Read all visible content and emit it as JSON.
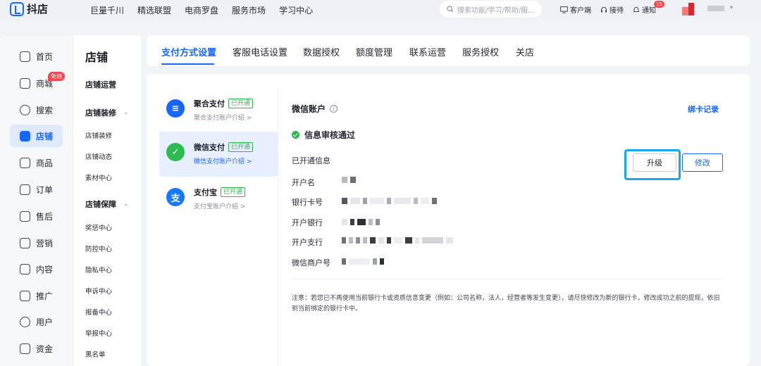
{
  "app": {
    "logo_text": "抖店"
  },
  "topnav": [
    "巨量千川",
    "精选联盟",
    "电商罗盘",
    "服务市场",
    "学习中心"
  ],
  "search": {
    "placeholder": "搜索功能/学习/帮助/服..."
  },
  "top_right": {
    "client": "客户端",
    "reception": "接待",
    "notify": "通知",
    "notify_count": "15"
  },
  "sidebar": {
    "items": [
      {
        "label": "首页",
        "icon": "home-icon"
      },
      {
        "label": "商城",
        "icon": "shop-icon",
        "badge": "免佣"
      },
      {
        "label": "搜索",
        "icon": "search-icon"
      },
      {
        "label": "店铺",
        "icon": "store-icon",
        "active": true
      },
      {
        "label": "商品",
        "icon": "goods-icon"
      },
      {
        "label": "订单",
        "icon": "order-icon"
      },
      {
        "label": "售后",
        "icon": "after-sale-icon"
      },
      {
        "label": "营销",
        "icon": "marketing-icon"
      },
      {
        "label": "内容",
        "icon": "content-icon"
      },
      {
        "label": "推广",
        "icon": "promote-icon"
      },
      {
        "label": "用户",
        "icon": "user-icon"
      },
      {
        "label": "资金",
        "icon": "fund-icon"
      }
    ]
  },
  "subnav": {
    "title": "店铺",
    "ops": "店铺运营",
    "decor_group": "店铺装修",
    "decor_items": [
      "店铺装修",
      "店铺动态",
      "素材中心"
    ],
    "guard_group": "店铺保障",
    "guard_items": [
      "奖惩中心",
      "防控中心",
      "隐私中心",
      "申诉中心",
      "报备中心",
      "举报中心",
      "黑名单"
    ]
  },
  "tabs": [
    "支付方式设置",
    "客服电话设置",
    "数据授权",
    "额度管理",
    "联系运营",
    "服务授权",
    "关店"
  ],
  "pay_methods": [
    {
      "name": "聚合支付",
      "tag": "已开通",
      "link": "聚合支付账户介绍 >",
      "color": "#1966ff"
    },
    {
      "name": "微信支付",
      "tag": "已开通",
      "link": "微信支付账户介绍 >",
      "color": "#2dbb4f",
      "active": true
    },
    {
      "name": "支付宝",
      "tag": "已开通",
      "link": "支付宝账户介绍 >",
      "color": "#1677ff"
    }
  ],
  "detail": {
    "title": "微信账户",
    "bind_record": "绑卡记录",
    "status": "信息审核通过",
    "opened_info": "已开通信息",
    "fields": [
      "开户名",
      "银行卡号",
      "开户银行",
      "开户支行",
      "微信商户号"
    ],
    "upgrade": "升级",
    "modify": "修改",
    "notice": "注意：若您已不再使用当前银行卡或资质信息变更（例如：公司名称，法人，经营者等发生变更），请尽快修改为新的银行卡，修改成功之前的提现，依旧到当前绑定的银行卡中。"
  }
}
